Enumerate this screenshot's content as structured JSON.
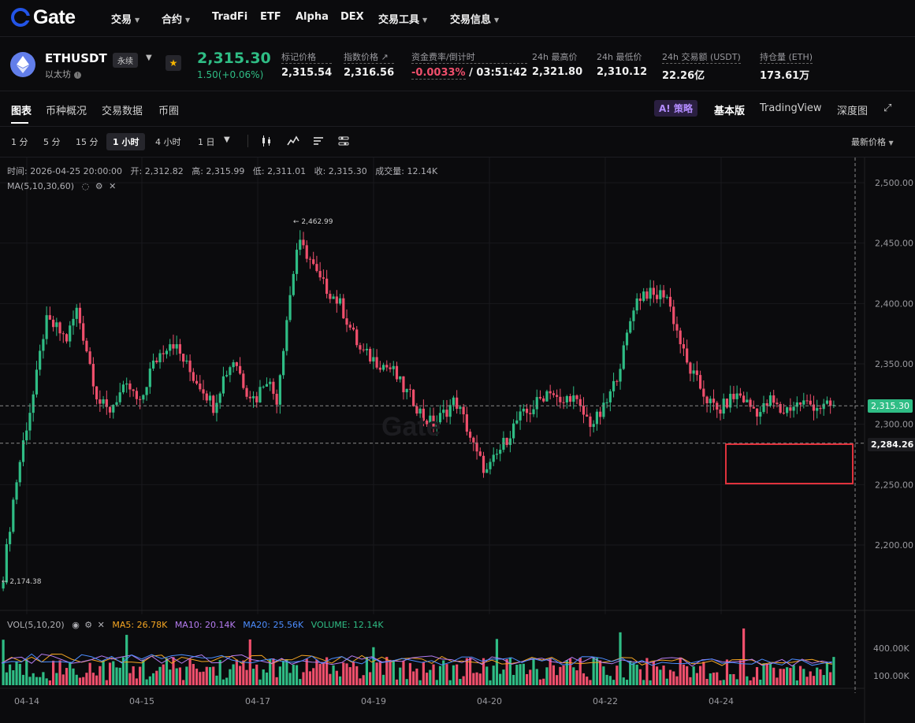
{
  "nav": {
    "logo": "Gate",
    "items": [
      {
        "label": "交易",
        "dropdown": true
      },
      {
        "label": "合约",
        "dropdown": true
      },
      {
        "label": "TradFi",
        "dropdown": false
      },
      {
        "label": "ETF",
        "dropdown": false
      },
      {
        "label": "Alpha",
        "dropdown": false
      },
      {
        "label": "DEX",
        "dropdown": false
      },
      {
        "label": "交易工具",
        "dropdown": true
      },
      {
        "label": "交易信息",
        "dropdown": true
      }
    ]
  },
  "ticker": {
    "symbol": "ETHUSDT",
    "badge": "永续",
    "name": "以太坊",
    "price": "2,315.30",
    "change": "1.50(+0.06%)",
    "stats": [
      {
        "label": "标记价格",
        "value": "2,315.54"
      },
      {
        "label": "指数价格 ↗",
        "value": "2,316.56"
      },
      {
        "label": "资金费率/倒计时",
        "value_neg": "-0.0033%",
        "value": " / 03:51:42"
      },
      {
        "label": "24h 最高价",
        "value": "2,321.80"
      },
      {
        "label": "24h 最低价",
        "value": "2,310.12"
      },
      {
        "label": "24h 交易额 (USDT)",
        "value": "22.26亿"
      },
      {
        "label": "持仓量 (ETH)",
        "value": "173.61万"
      }
    ]
  },
  "tabs": [
    "图表",
    "币种概况",
    "交易数据",
    "币圈"
  ],
  "right_tabs": {
    "ai": "A! 策略",
    "basic": "基本版",
    "tradingview": "TradingView",
    "depth": "深度图"
  },
  "timeframes": [
    "1 分",
    "5 分",
    "15 分",
    "1 小时",
    "4 小时",
    "1 日"
  ],
  "active_timeframe": "1 小时",
  "price_source": "最新价格",
  "chart_info": {
    "time": "时间: 2026-04-25 20:00:00",
    "open": "开: 2,312.82",
    "high": "高: 2,315.99",
    "low": "低: 2,311.01",
    "close": "收: 2,315.30",
    "volume": "成交量: 12.14K"
  },
  "ma_label": "MA(5,10,30,60)",
  "vol_label": "VOL(5,10,20)",
  "vol_ma5": "MA5: 26.78K",
  "vol_ma10": "MA10: 20.14K",
  "vol_ma20": "MA20: 25.56K",
  "vol_volume": "VOLUME: 12.14K",
  "current_price_tag": "2,315.30",
  "crosshair_price_tag": "2,284.26",
  "high_marker": "2,462.99",
  "low_marker": "2,174.38",
  "watermark": "Gate",
  "colors": {
    "up": "#2fbd85",
    "down": "#ef4f6c",
    "bg": "#0b0b0d"
  },
  "chart_data": {
    "type": "candlestick",
    "y_ticks": [
      "2,500.00",
      "2,450.00",
      "2,400.00",
      "2,350.00",
      "2,300.00",
      "2,250.00",
      "2,200.00"
    ],
    "y_tick_values": [
      2500,
      2450,
      2400,
      2350,
      2300,
      2250,
      2200
    ],
    "x_ticks": [
      "04-14",
      "04-15",
      "04-17",
      "04-19",
      "04-20",
      "04-22",
      "04-24"
    ],
    "vol_ticks": [
      "400.00K",
      "100.00K"
    ],
    "ylim": [
      2160,
      2520
    ],
    "close_path": [
      2175,
      2240,
      2290,
      2330,
      2385,
      2380,
      2370,
      2395,
      2360,
      2320,
      2310,
      2325,
      2330,
      2315,
      2345,
      2360,
      2370,
      2355,
      2340,
      2330,
      2315,
      2340,
      2355,
      2330,
      2320,
      2340,
      2320,
      2390,
      2450,
      2440,
      2420,
      2410,
      2400,
      2380,
      2360,
      2355,
      2350,
      2345,
      2330,
      2320,
      2305,
      2300,
      2310,
      2320,
      2300,
      2275,
      2260,
      2275,
      2290,
      2305,
      2310,
      2320,
      2330,
      2315,
      2325,
      2310,
      2300,
      2310,
      2330,
      2360,
      2400,
      2410,
      2405,
      2410,
      2380,
      2350,
      2335,
      2320,
      2310,
      2320,
      2325,
      2315,
      2310,
      2320,
      2310,
      2315,
      2318,
      2316,
      2314,
      2315
    ]
  }
}
